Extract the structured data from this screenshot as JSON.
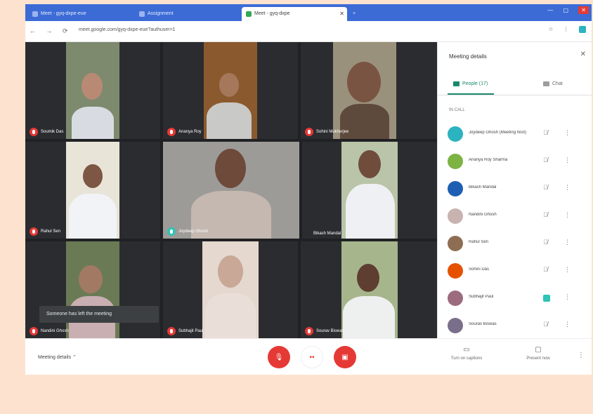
{
  "browser": {
    "tabs": [
      {
        "label": "Meet - gyq-dxpe-eue",
        "active": false
      },
      {
        "label": "Assignment",
        "active": false
      },
      {
        "label": "Meet - gyq-dxpe",
        "active": true
      }
    ],
    "url": "meet.google.com/gyq-dxpe-eue?authuser=1"
  },
  "tiles": [
    {
      "name": "Soumik Das",
      "mic": "muted"
    },
    {
      "name": "Ananya Roy",
      "mic": "muted"
    },
    {
      "name": "Sohini Mukherjee",
      "mic": "muted"
    },
    {
      "name": "Rahul Sen",
      "mic": "muted"
    },
    {
      "name": "Joydeep Ghosh",
      "mic": "on"
    },
    {
      "name": "Bikash Mandal",
      "mic": "dot"
    },
    {
      "name": "Nandini Ghosh",
      "mic": "muted"
    },
    {
      "name": "Subhajit Paul",
      "mic": "muted"
    },
    {
      "name": "Sourav Biswas",
      "mic": "muted"
    }
  ],
  "tooltip": "Someone has left the meeting",
  "panel": {
    "title": "Meeting details",
    "tabs": [
      {
        "label": "People (17)"
      },
      {
        "label": "Chat"
      }
    ],
    "section": "IN CALL",
    "people": [
      {
        "name": "Joydeep Ghosh (Meeting host)",
        "avatar_color": "#2bb3c0",
        "mic": "muted"
      },
      {
        "name": "Ananya Roy Sharma",
        "avatar_color": "#7cb342",
        "mic": "muted"
      },
      {
        "name": "Bikash Mandal",
        "avatar_color": "#1e5fb4",
        "mic": "muted"
      },
      {
        "name": "Nandini Ghosh",
        "avatar_color": "#c8b3b0",
        "mic": "muted"
      },
      {
        "name": "Rahul Sen",
        "avatar_color": "#8d6e52",
        "mic": "muted"
      },
      {
        "name": "Sohini Das",
        "avatar_color": "#e65100",
        "mic": "muted"
      },
      {
        "name": "Subhajit Paul",
        "avatar_color": "#9c6b7e",
        "mic": "on"
      },
      {
        "name": "Sourav Biswas",
        "avatar_color": "#7a6f8a",
        "mic": "muted"
      }
    ]
  },
  "bottom": {
    "meeting_details": "Meeting details ⌃",
    "turn_on_captions": "Turn on captions",
    "present_now": "Present now"
  },
  "colors": {
    "accent": "#1a8a6c",
    "mute_red": "#e53935",
    "tab_blue": "#3c6bd6"
  }
}
